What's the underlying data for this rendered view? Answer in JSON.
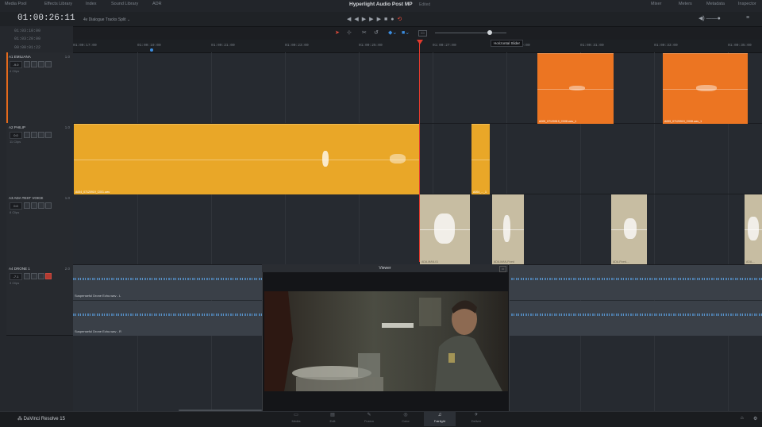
{
  "topbar": {
    "items_left": [
      "Media Pool",
      "Effects Library",
      "Index",
      "Sound Library",
      "ADR"
    ],
    "project_title": "Hyperlight Audio Post MP",
    "status": "Edited",
    "items_right": [
      "Mixer",
      "Meters",
      "Metadata",
      "Inspector"
    ]
  },
  "header": {
    "timecode": "01:00:26:11",
    "timeline_name": "4v Dialogue Tracks Split ⌄",
    "tc_rows": [
      "01:03:10:00",
      "01:03:20:00",
      "00:00:01:22"
    ]
  },
  "ruler": {
    "ticks": [
      "01:00:17:00",
      "01:00:19:00",
      "01:00:21:00",
      "01:00:23:00",
      "01:00:25:00",
      "01:00:27:00",
      "01:00:29:00",
      "01:00:31:00",
      "01:00:33:00",
      "01:00:35:00"
    ]
  },
  "tracks": [
    {
      "name": "A1   EMILIANA",
      "format": "1.0",
      "volume": "-9.0",
      "clips": "4 Clips"
    },
    {
      "name": "A2   PHILIP",
      "format": "1.0",
      "volume": "0.0",
      "clips": "11 Clips"
    },
    {
      "name": "A3   ADA TEST VOICE",
      "format": "1.0",
      "volume": "0.0",
      "clips": "8 Clips"
    },
    {
      "name": "A4   DRONE 1",
      "format": "2.0",
      "volume": "-7.1",
      "clips": "3 Clips"
    }
  ],
  "clips": {
    "a1_1": "A005_07120919_C008.wav_1",
    "a1_2": "A005_07120919_C008.wav_1",
    "a2_1": "A004_07120919_C001.wav",
    "a2_2": "A004_..._1",
    "a3_1": "ADA-MAN-01",
    "a3_2": "ADA-MAN-Fixed",
    "a3_3": "ADA-Fixed-...",
    "a3_4": "ADA-..."
  },
  "drone_labels": [
    "Suspenseful Drone Echo.wav - L",
    "Suspenseful Drone Echo.wav - R"
  ],
  "tooltip": "Horizontal Slider",
  "viewer": {
    "title": "Viewer"
  },
  "bottom": {
    "brand": "DaVinci Resolve 15",
    "pages": [
      "Media",
      "Edit",
      "Fusion",
      "Color",
      "Fairlight",
      "Deliver"
    ],
    "active_page": "Fairlight"
  },
  "colors": {
    "orange_clip": "#ec7522",
    "yellow_clip": "#e9a728",
    "tan_clip": "#c7bda2",
    "playhead": "#e23b2e"
  }
}
